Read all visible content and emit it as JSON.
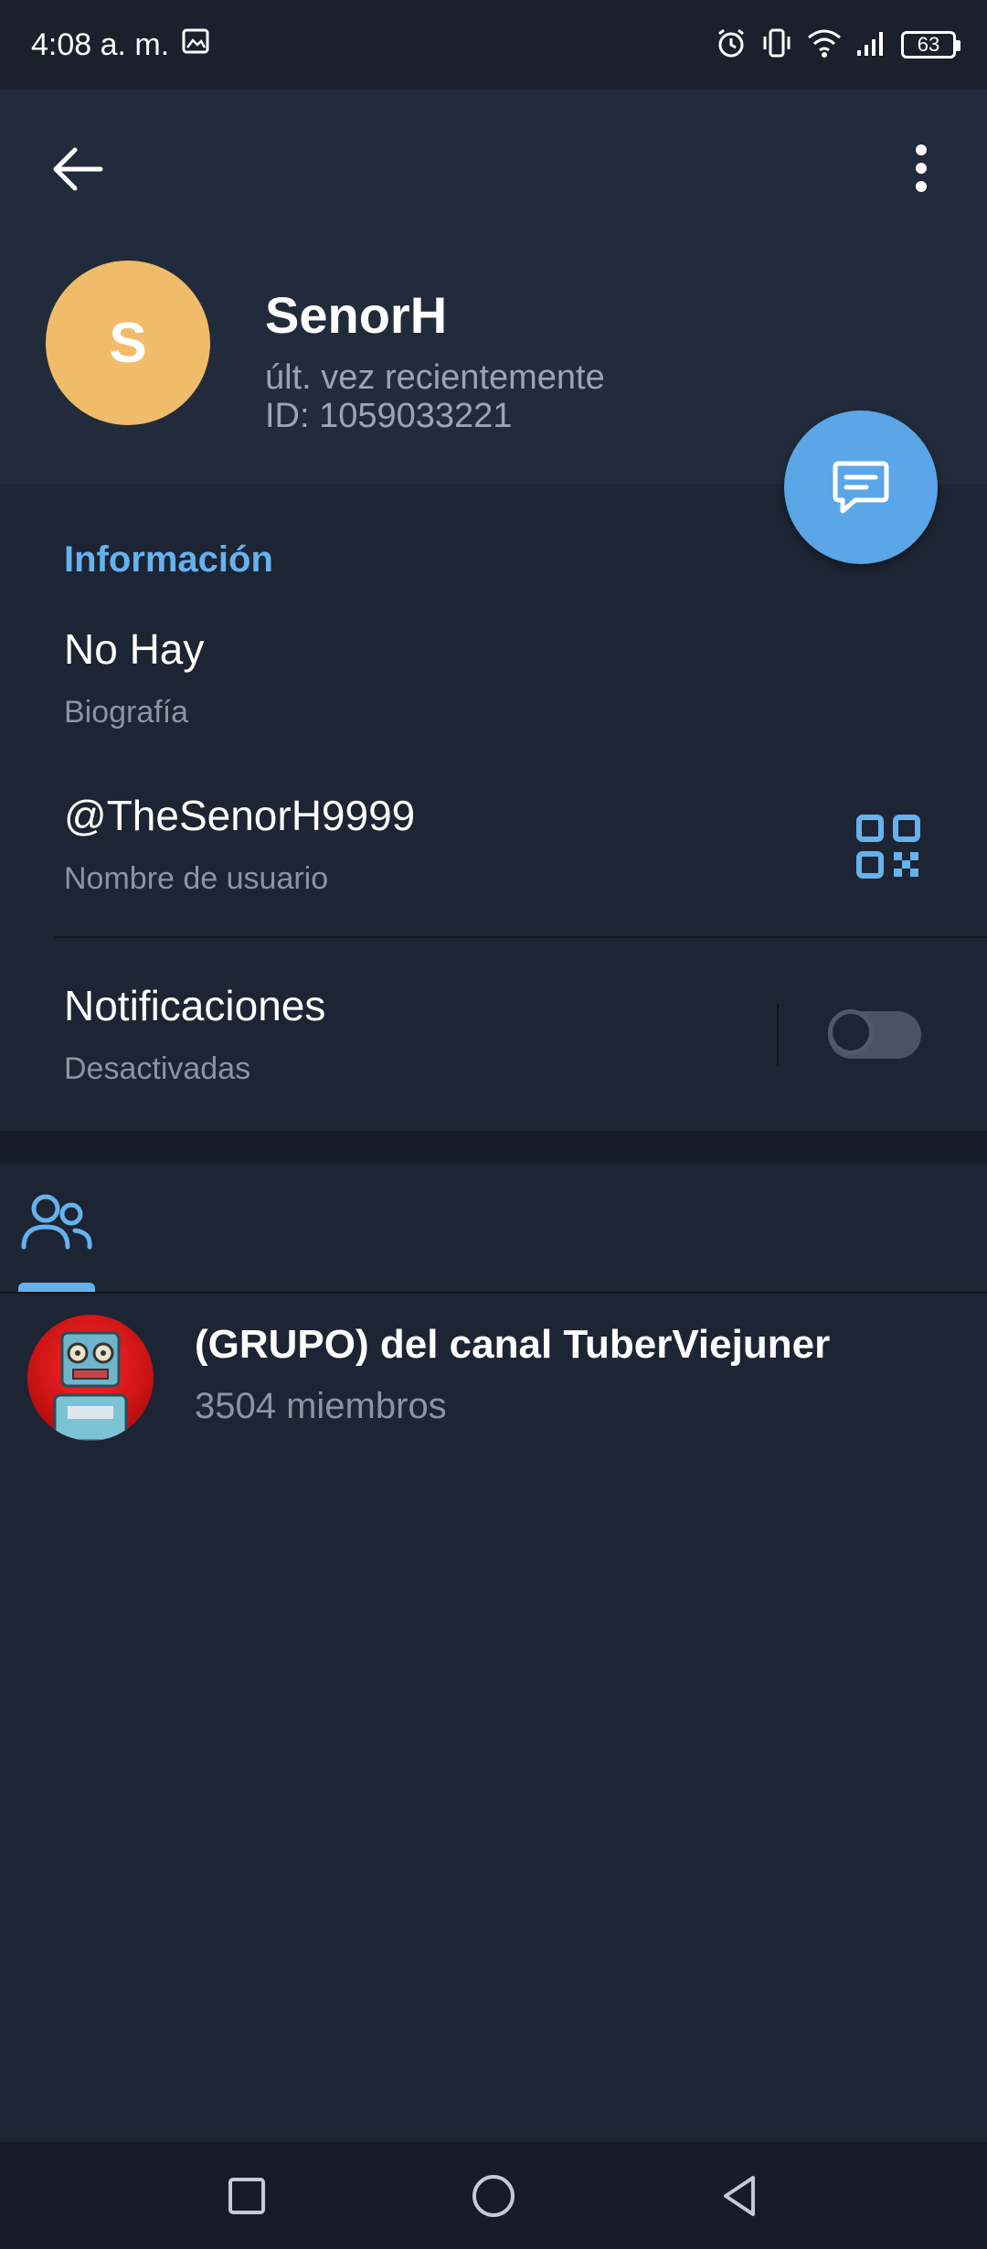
{
  "status_bar": {
    "time": "4:08 a. m.",
    "battery": "63",
    "icons": [
      "gallery-icon",
      "alarm-icon",
      "vibrate-icon",
      "wifi-icon",
      "signal-icon",
      "battery-icon"
    ]
  },
  "header": {
    "back_icon": "arrow-left-icon",
    "more_icon": "more-vertical-icon",
    "avatar_letter": "S",
    "avatar_color": "#f0bc69",
    "name": "SenorH",
    "status": "últ. vez recientemente",
    "id": "ID: 1059033221",
    "fab_icon": "message-icon",
    "fab_color": "#5ba6e6"
  },
  "info": {
    "section_title": "Información",
    "bio_value": "No Hay",
    "bio_label": "Biografía",
    "username_value": "@TheSenorH9999",
    "username_label": "Nombre de usuario",
    "qr_icon": "qr-code-icon",
    "notifications_title": "Notificaciones",
    "notifications_status": "Desactivadas",
    "notifications_enabled": false
  },
  "tabs": {
    "active_icon": "groups-icon",
    "accent": "#65b2ee"
  },
  "groups": [
    {
      "name": "(GRUPO) del canal TuberViejuner",
      "members": "3504 miembros"
    }
  ],
  "nav_bar": {
    "icons": [
      "square-icon",
      "circle-icon",
      "triangle-back-icon"
    ]
  },
  "colors": {
    "background": "#1d2433",
    "header_background": "#222b3b",
    "secondary_text": "#8a95a4"
  }
}
